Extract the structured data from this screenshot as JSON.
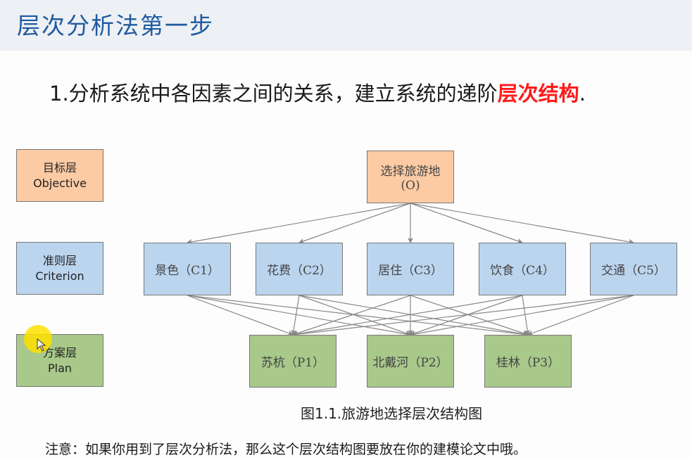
{
  "header": {
    "title": "层次分析法第一步"
  },
  "subtitle": {
    "prefix": "1.分析系统中各因素之间的关系，建立系统的递阶",
    "highlight": "层次结构",
    "suffix": ".",
    "highlight_color": "#ff1a1a"
  },
  "legend": [
    {
      "cn": "目标层",
      "en": "Objective"
    },
    {
      "cn": "准则层",
      "en": "Criterion"
    },
    {
      "cn": "方案层",
      "en": "Plan"
    }
  ],
  "diagram": {
    "goal": {
      "line1": "选择旅游地",
      "line2": "(O)"
    },
    "criteria": [
      "景色（C1）",
      "花费（C2）",
      "居住（C3）",
      "饮食（C4）",
      "交通（C5）"
    ],
    "plans": [
      "苏杭（P1）",
      "北戴河（P2）",
      "桂林（P3）"
    ],
    "colors": {
      "goal": "#fccba4",
      "criteria": "#bcd5ef",
      "plans": "#a8c98a"
    }
  },
  "caption": "图1.1.旅游地选择层次结构图",
  "note": "注意：如果你用到了层次分析法，那么这个层次结构图要放在你的建模论文中哦。"
}
